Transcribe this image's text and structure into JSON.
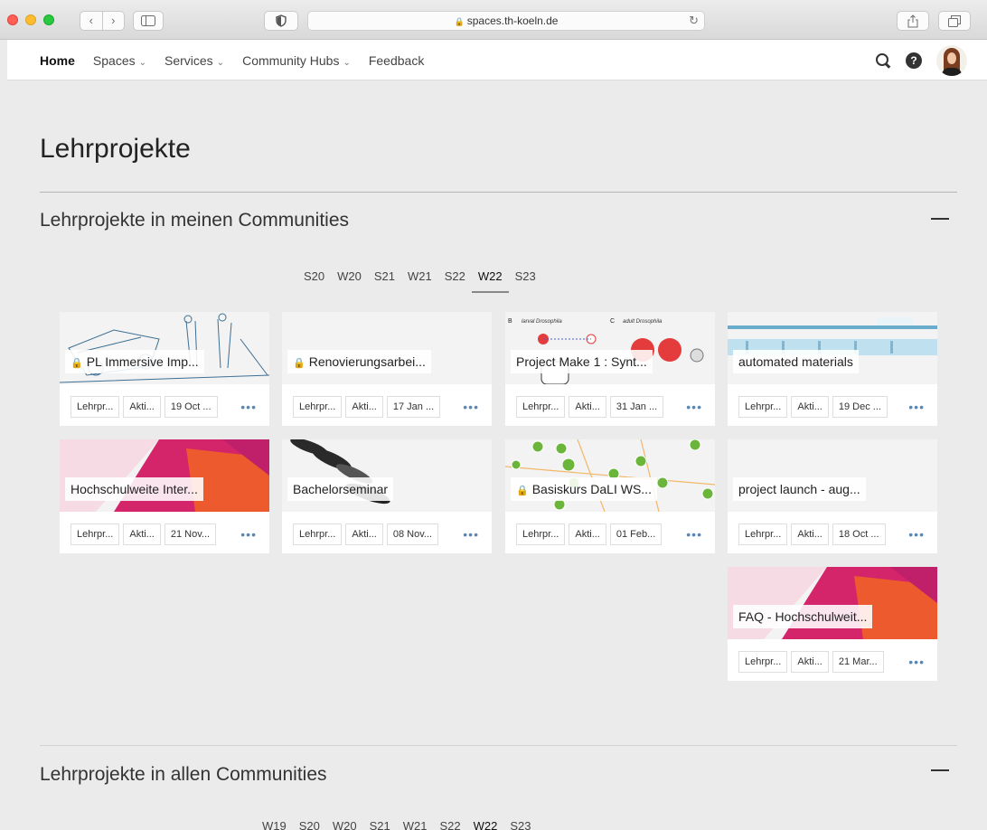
{
  "browser": {
    "url": "spaces.th-koeln.de",
    "back_glyph": "‹",
    "forward_glyph": "›",
    "reload_glyph": "↻"
  },
  "nav": {
    "home": "Home",
    "spaces": "Spaces",
    "services": "Services",
    "community_hubs": "Community Hubs",
    "feedback": "Feedback",
    "chevron": "⌄"
  },
  "page": {
    "title": "Lehrprojekte"
  },
  "section1": {
    "title": "Lehrprojekte in meinen Communities",
    "semesters": [
      "S20",
      "W20",
      "S21",
      "W21",
      "S22",
      "W22",
      "S23"
    ],
    "selected": "W22"
  },
  "cards": [
    {
      "title": "PL Immersive Imp...",
      "locked": true,
      "tags": [
        "Lehrpr...",
        "Akti...",
        "19 Oct ..."
      ],
      "image": "blue"
    },
    {
      "title": "Renovierungsarbei...",
      "locked": true,
      "tags": [
        "Lehrpr...",
        "Akti...",
        "17 Jan ..."
      ],
      "image": "grey"
    },
    {
      "title": "Project Make 1 : Synt...",
      "locked": false,
      "tags": [
        "Lehrpr...",
        "Akti...",
        "31 Jan ..."
      ],
      "image": "white"
    },
    {
      "title": "automated materials",
      "locked": false,
      "tags": [
        "Lehrpr...",
        "Akti...",
        "19 Dec ..."
      ],
      "image": "machine"
    },
    {
      "title": "Hochschulweite Inter...",
      "locked": false,
      "tags": [
        "Lehrpr...",
        "Akti...",
        "21 Nov..."
      ],
      "image": "geo"
    },
    {
      "title": "Bachelorseminar",
      "locked": false,
      "tags": [
        "Lehrpr...",
        "Akti...",
        "08 Nov..."
      ],
      "image": "bw"
    },
    {
      "title": "Basiskurs DaLI WS...",
      "locked": true,
      "tags": [
        "Lehrpr...",
        "Akti...",
        "01 Feb..."
      ],
      "image": "map"
    },
    {
      "title": "project launch - aug...",
      "locked": false,
      "tags": [
        "Lehrpr...",
        "Akti...",
        "18 Oct ..."
      ],
      "image": "grey"
    },
    {
      "title": "FAQ - Hochschulweit...",
      "locked": false,
      "tags": [
        "Lehrpr...",
        "Akti...",
        "21 Mar..."
      ],
      "image": "geo"
    }
  ],
  "more_label": "•••",
  "lock_glyph": "🔒",
  "drosophila": {
    "larval": "larval Drosophila",
    "adult": "adult Drosophila",
    "b": "B",
    "c": "C"
  },
  "section2": {
    "title": "Lehrprojekte in allen Communities",
    "semesters": [
      "W19",
      "S20",
      "W20",
      "S21",
      "W21",
      "S22",
      "W22",
      "S23"
    ],
    "selected": "W22"
  }
}
